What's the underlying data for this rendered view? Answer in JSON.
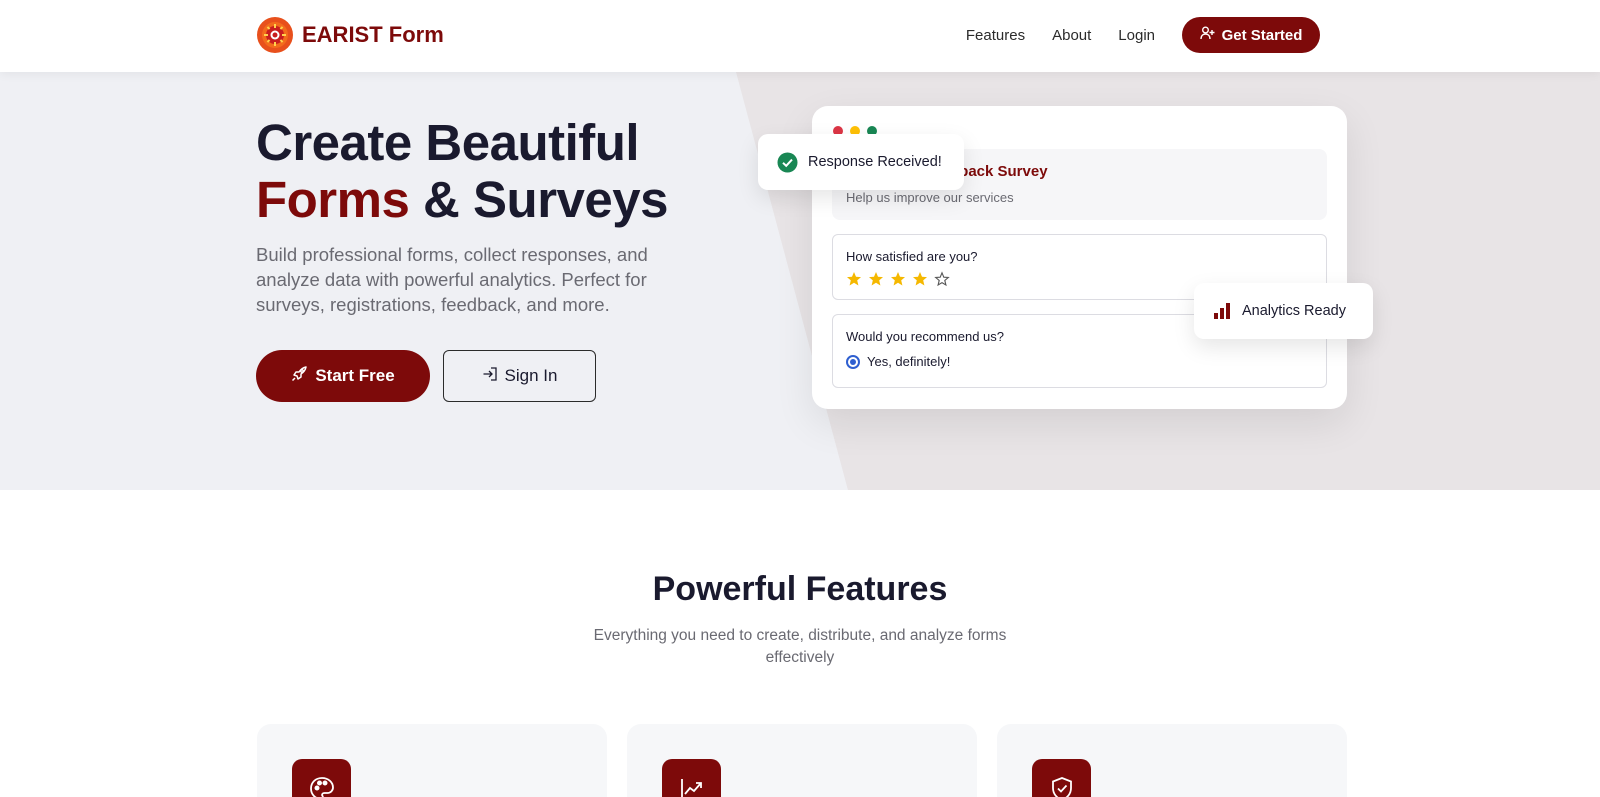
{
  "brand": {
    "name": "EARIST Form",
    "logo_icon": "gear-logo-icon",
    "color": "#7d0a0a"
  },
  "nav": {
    "links": [
      "Features",
      "About",
      "Login"
    ],
    "cta_label": "Get Started",
    "cta_icon": "user-plus-icon"
  },
  "hero": {
    "title_line1": "Create Beautiful",
    "title_accent": "Forms",
    "title_rest": " & Surveys",
    "description": "Build professional forms, collect responses, and analyze data with powerful analytics. Perfect for surveys, registrations, feedback, and more.",
    "primary_button": "Start Free",
    "primary_icon": "rocket-icon",
    "secondary_button": "Sign In",
    "secondary_icon": "sign-in-icon"
  },
  "mockup": {
    "survey_title": "dback Survey",
    "survey_subtitle": "Help us improve our services",
    "question1": "How satisfied are you?",
    "rating": 4,
    "rating_max": 5,
    "question2": "Would you recommend us?",
    "answer": "Yes, definitely!",
    "toast": "Response Received!",
    "badge": "Analytics Ready",
    "colors": {
      "dot_red": "#dc3545",
      "dot_yellow": "#ffc107",
      "dot_green": "#198754",
      "star": "#f5b800",
      "check": "#198754"
    }
  },
  "features": {
    "title": "Powerful Features",
    "subtitle": "Everything you need to create, distribute, and analyze forms effectively",
    "cards": [
      {
        "icon": "palette-icon"
      },
      {
        "icon": "chart-line-icon"
      },
      {
        "icon": "shield-check-icon"
      }
    ]
  }
}
